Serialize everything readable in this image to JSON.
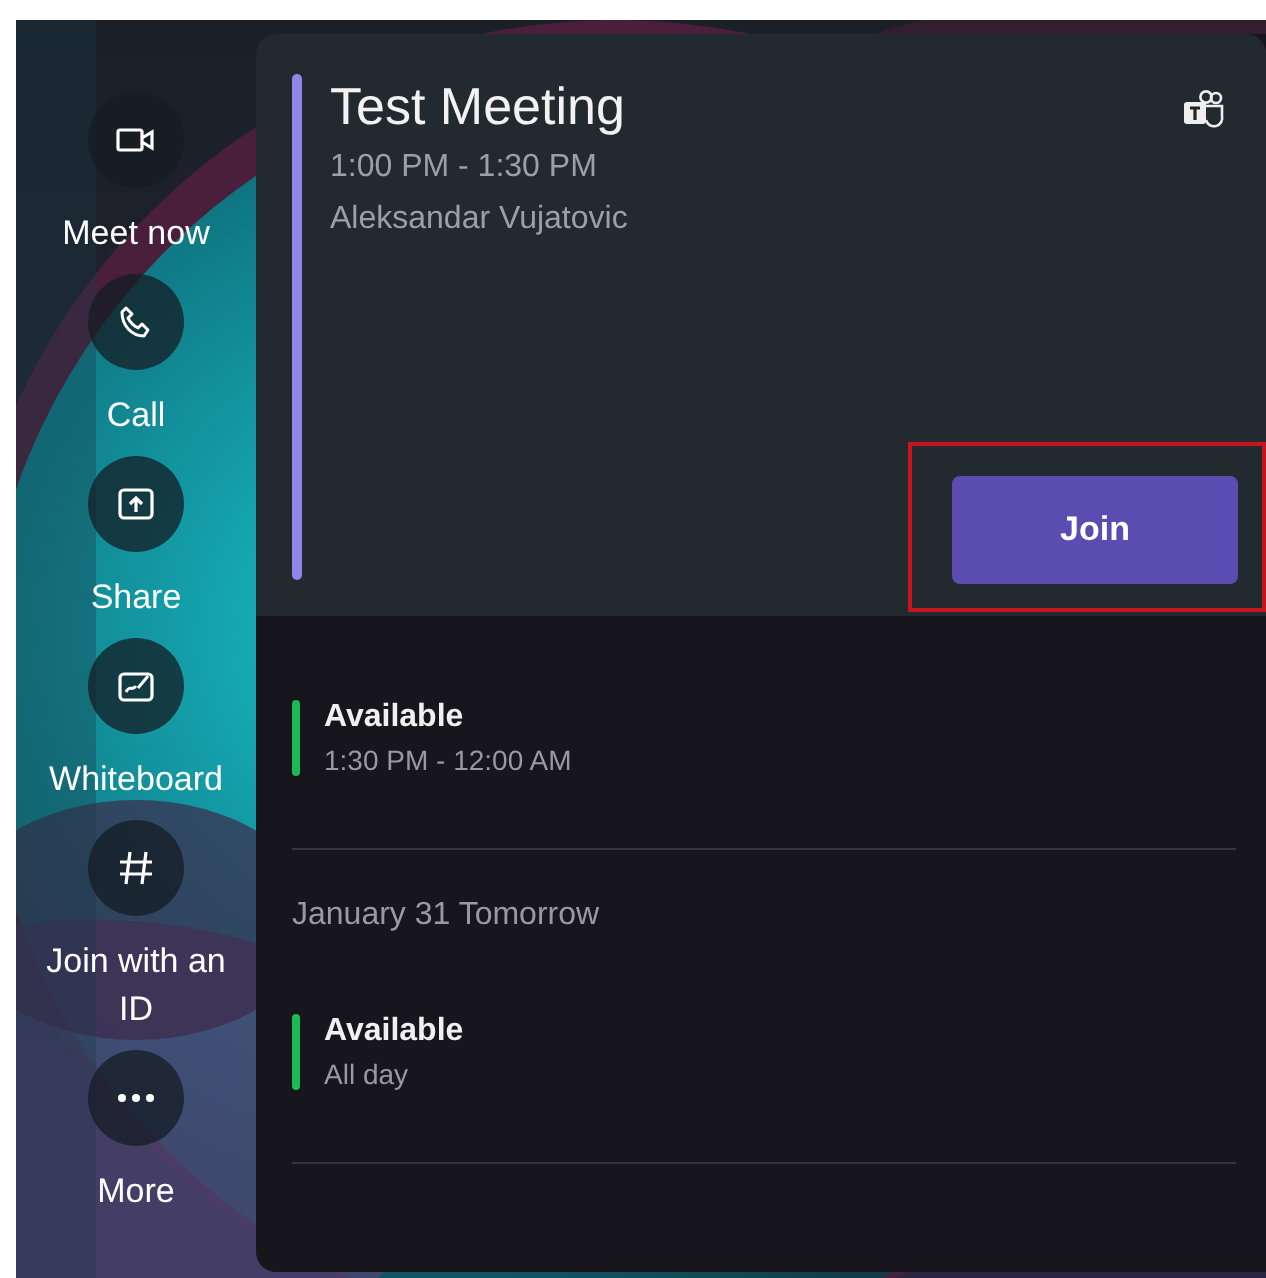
{
  "sidebar": {
    "items": [
      {
        "label": "Meet now",
        "kind": "video"
      },
      {
        "label": "Call",
        "kind": "phone"
      },
      {
        "label": "Share",
        "kind": "share"
      },
      {
        "label": "Whiteboard",
        "kind": "whiteboard"
      },
      {
        "label": "Join with an ID",
        "kind": "hash"
      },
      {
        "label": "More",
        "kind": "more"
      }
    ]
  },
  "meeting": {
    "title": "Test Meeting",
    "time": "1:00 PM - 1:30 PM",
    "organizer": "Aleksandar Vujatovic",
    "join_button": {
      "label": "Join",
      "highlighted": true
    }
  },
  "agenda": [
    {
      "kind": "slot",
      "title": "Available",
      "time": "1:30 PM - 12:00 AM",
      "color": "#1db954"
    },
    {
      "kind": "date",
      "label": "January 31 Tomorrow"
    },
    {
      "kind": "slot",
      "title": "Available",
      "time": "All day",
      "color": "#1db954"
    }
  ]
}
